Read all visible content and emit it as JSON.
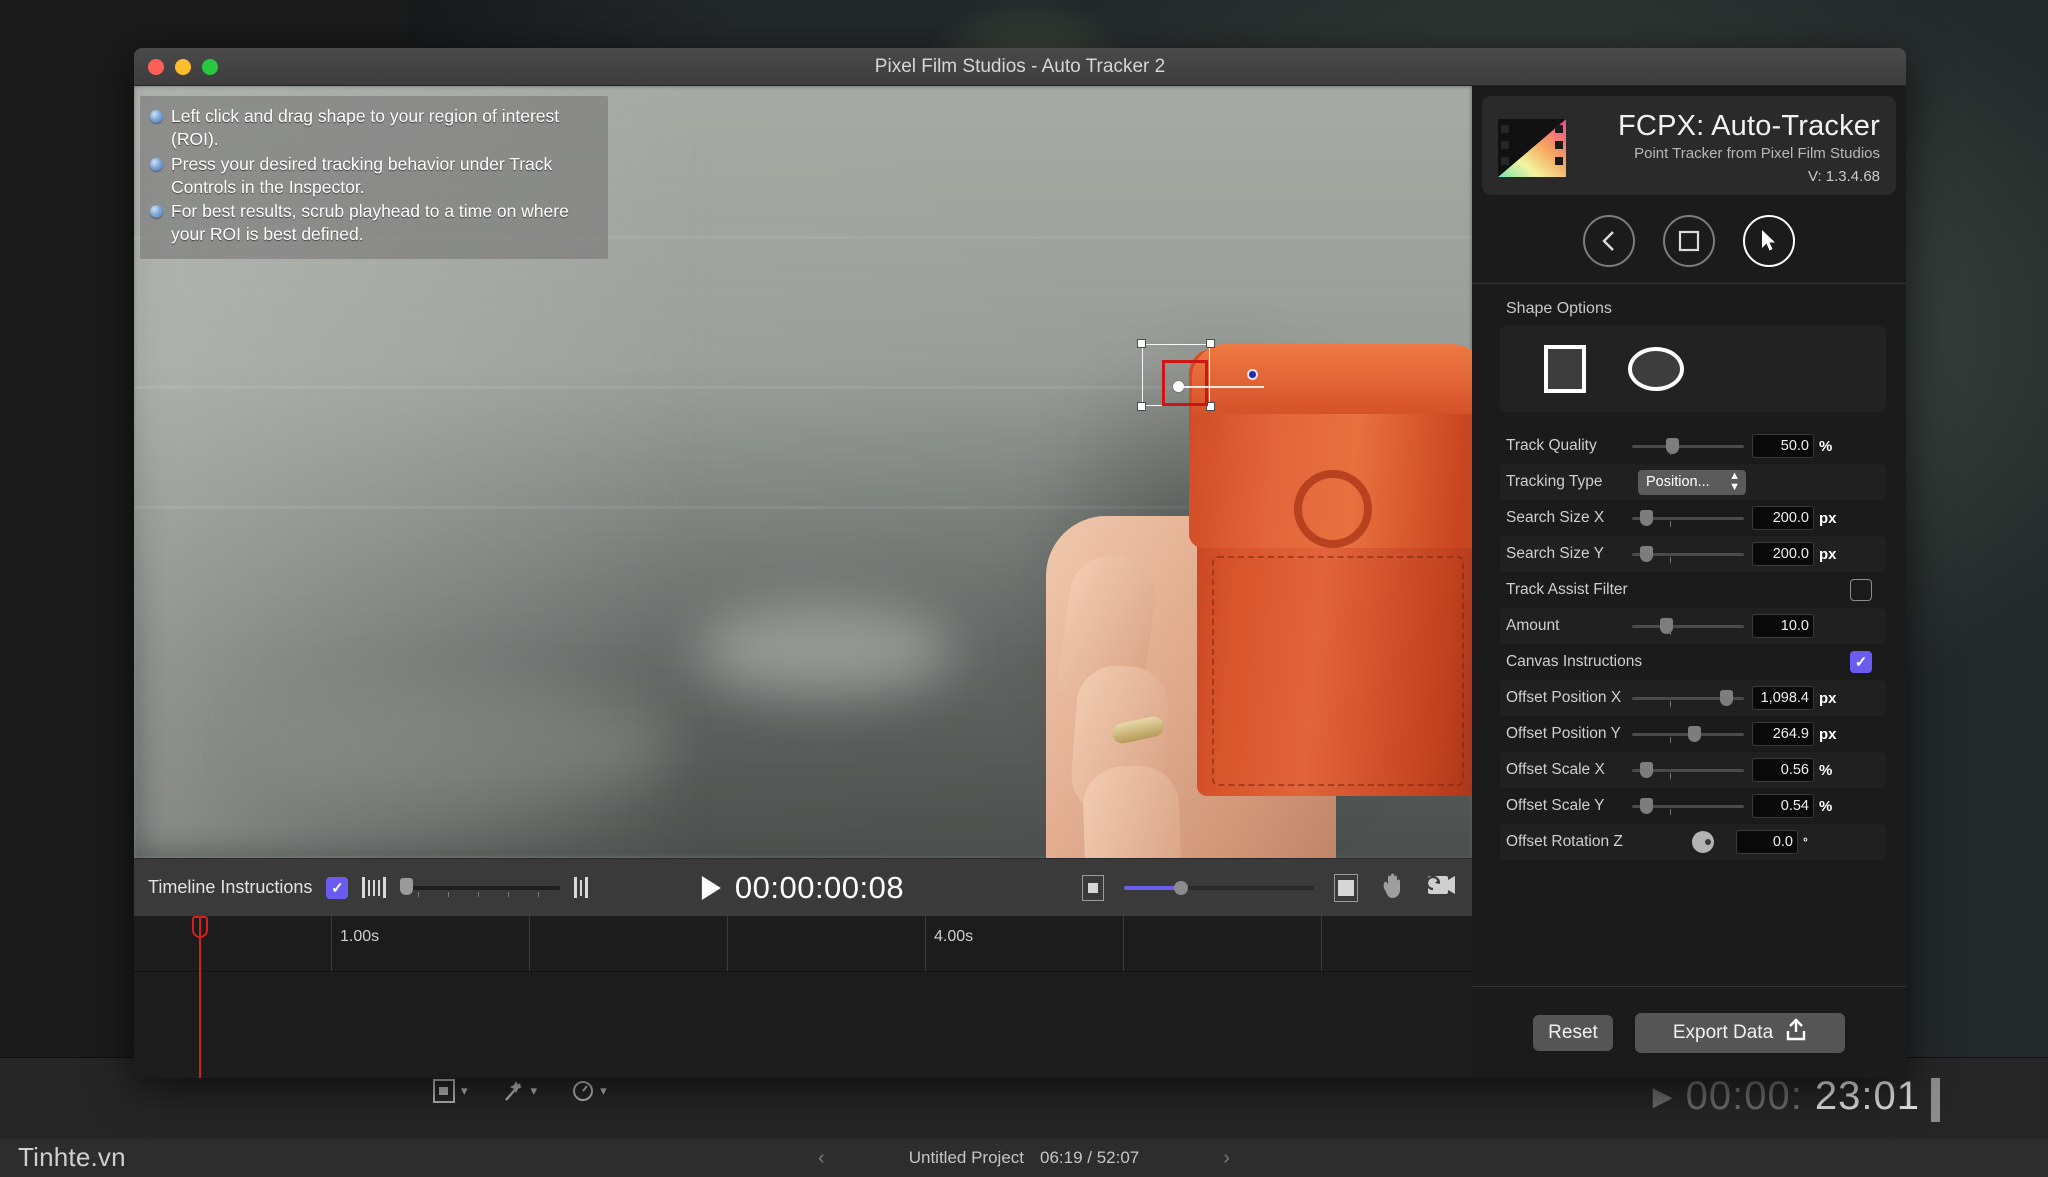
{
  "window": {
    "title": "Pixel Film Studios - Auto Tracker 2",
    "traffic_lights": [
      "close",
      "minimize",
      "zoom"
    ]
  },
  "canvas": {
    "instructions": [
      "Left click and drag shape to your region of interest (ROI).",
      "Press your desired tracking behavior under Track Controls in the Inspector.",
      "For best results, scrub playhead to a time on where your ROI is best defined."
    ],
    "roi": {
      "label": "region-of-interest-selection"
    }
  },
  "transport": {
    "timeline_instructions_label": "Timeline Instructions",
    "timeline_instructions_checked": true,
    "timecode": "00:00:00:08",
    "play_icon": "play-icon",
    "hand_icon": "hand-tool-icon",
    "loop_icon": "loop-playback-icon"
  },
  "timeline": {
    "ruler_labels": [
      "1.00s",
      "4.00s"
    ],
    "playhead_position": "0.00s"
  },
  "inspector": {
    "brand": {
      "title": "FCPX: Auto-Tracker",
      "subtitle": "Point Tracker from Pixel Film Studios",
      "version": "V: 1.3.4.68"
    },
    "nav": [
      {
        "name": "back-button",
        "icon": "chevron-left-icon"
      },
      {
        "name": "stop-button",
        "icon": "square-icon"
      },
      {
        "name": "select-tool-button",
        "icon": "cursor-arrow-icon",
        "active": true
      }
    ],
    "shape_options": {
      "label": "Shape Options",
      "shapes": [
        {
          "name": "rectangle-shape",
          "selected": true
        },
        {
          "name": "ellipse-shape",
          "selected": false
        }
      ]
    },
    "parameters": [
      {
        "label": "Track Quality",
        "control": "slider",
        "value": "50.0",
        "unit": "%",
        "knob_pct": 34,
        "reset": true,
        "keyframe": false
      },
      {
        "label": "Tracking Type",
        "control": "dropdown",
        "value": "Position...",
        "unit": "",
        "reset": true,
        "keyframe": false
      },
      {
        "label": "Search Size X",
        "control": "slider",
        "value": "200.0",
        "unit": "px",
        "knob_pct": 8,
        "reset": true,
        "keyframe": false
      },
      {
        "label": "Search Size Y",
        "control": "slider",
        "value": "200.0",
        "unit": "px",
        "knob_pct": 8,
        "reset": true,
        "keyframe": false
      },
      {
        "label": "Track Assist Filter",
        "control": "checkbox",
        "value": "",
        "unit": "",
        "checked": false,
        "reset": false,
        "keyframe": false
      },
      {
        "label": "Amount",
        "control": "slider",
        "value": "10.0",
        "unit": "",
        "knob_pct": 28,
        "reset": false,
        "keyframe": false
      },
      {
        "label": "Canvas Instructions",
        "control": "checkbox",
        "value": "",
        "unit": "",
        "checked": true,
        "reset": true,
        "keyframe": false
      },
      {
        "label": "Offset Position X",
        "control": "slider",
        "value": "1,098.4",
        "unit": "px",
        "knob_pct": 86,
        "reset": true,
        "keyframe": true
      },
      {
        "label": "Offset Position Y",
        "control": "slider",
        "value": "264.9",
        "unit": "px",
        "knob_pct": 57,
        "reset": true,
        "keyframe": true
      },
      {
        "label": "Offset Scale X",
        "control": "slider",
        "value": "0.56",
        "unit": "%",
        "knob_pct": 8,
        "reset": true,
        "keyframe": true
      },
      {
        "label": "Offset Scale Y",
        "control": "slider",
        "value": "0.54",
        "unit": "%",
        "knob_pct": 8,
        "reset": true,
        "keyframe": true
      },
      {
        "label": "Offset Rotation Z",
        "control": "dial",
        "value": "0.0",
        "unit": "°",
        "reset": true,
        "keyframe": true
      }
    ],
    "footer": {
      "reset_label": "Reset",
      "export_label": "Export Data",
      "export_icon": "share-upload-icon"
    }
  },
  "host_app": {
    "timecode_dim": "00:00:",
    "timecode_bright": "23:01",
    "project_name": "Untitled Project",
    "project_duration": "06:19 / 52:07",
    "prev_icon": "chevron-left-icon",
    "next_icon": "chevron-right-icon",
    "watermark": "Tinhte.vn"
  },
  "colors": {
    "accent_purple": "#6b5cf0",
    "roi_red": "#cc1515",
    "playhead_red": "#d32020",
    "panel_bg": "#1b1b1b"
  }
}
